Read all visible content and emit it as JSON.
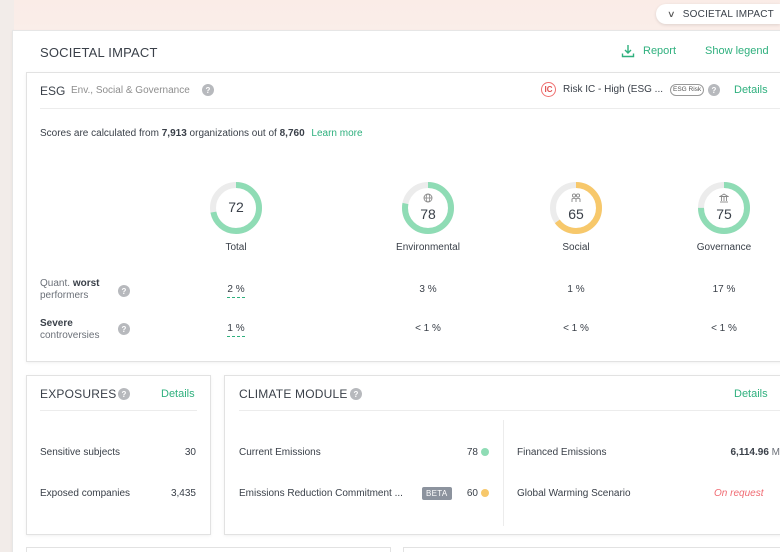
{
  "top_pill": {
    "label": "SOCIETAL IMPACT"
  },
  "header": {
    "title": "SOCIETAL IMPACT",
    "report_label": "Report",
    "legend_label": "Show legend"
  },
  "esg": {
    "title": "ESG",
    "subtitle": "Env., Social & Governance",
    "risk_icon_text": "IC",
    "risk_label": "Risk IC - High (ESG ...",
    "risk_badge": "ESG Risk",
    "details_label": "Details",
    "note_prefix": "Scores are calculated from",
    "note_count": "7,913",
    "note_mid": "organizations out of",
    "note_total": "8,760",
    "learn_more": "Learn more",
    "scores": [
      {
        "label": "Total",
        "value": "72",
        "percent": 72,
        "color": "#8fdcb5"
      },
      {
        "label": "Environmental",
        "value": "78",
        "percent": 78,
        "color": "#8fdcb5"
      },
      {
        "label": "Social",
        "value": "65",
        "percent": 65,
        "color": "#f7c86b"
      },
      {
        "label": "Governance",
        "value": "75",
        "percent": 75,
        "color": "#8fdcb5"
      }
    ],
    "rows": [
      {
        "label_pre": "Quant. ",
        "label_bold": "worst",
        "label_post": "performers",
        "values": [
          "2 %",
          "3 %",
          "1 %",
          "17 %"
        ]
      },
      {
        "label_pre": "",
        "label_bold": "Severe",
        "label_post": "controversies",
        "values": [
          "1 %",
          "< 1 %",
          "< 1 %",
          "< 1 %"
        ]
      }
    ]
  },
  "exposures": {
    "title": "EXPOSURES",
    "details_label": "Details",
    "items": [
      {
        "label": "Sensitive subjects",
        "value": "30"
      },
      {
        "label": "Exposed companies",
        "value": "3,435"
      }
    ]
  },
  "climate": {
    "title": "CLIMATE MODULE",
    "details_label": "Details",
    "current_emissions_label": "Current Emissions",
    "current_emissions_value": "78",
    "current_emissions_color": "#8fdcb5",
    "reduction_label": "Emissions Reduction Commitment ...",
    "beta_label": "BETA",
    "reduction_value": "60",
    "reduction_color": "#f7c86b",
    "financed_label": "Financed Emissions",
    "financed_value": "6,114.96",
    "financed_unit": "M",
    "warming_label": "Global Warming Scenario",
    "warming_value": "On request"
  }
}
